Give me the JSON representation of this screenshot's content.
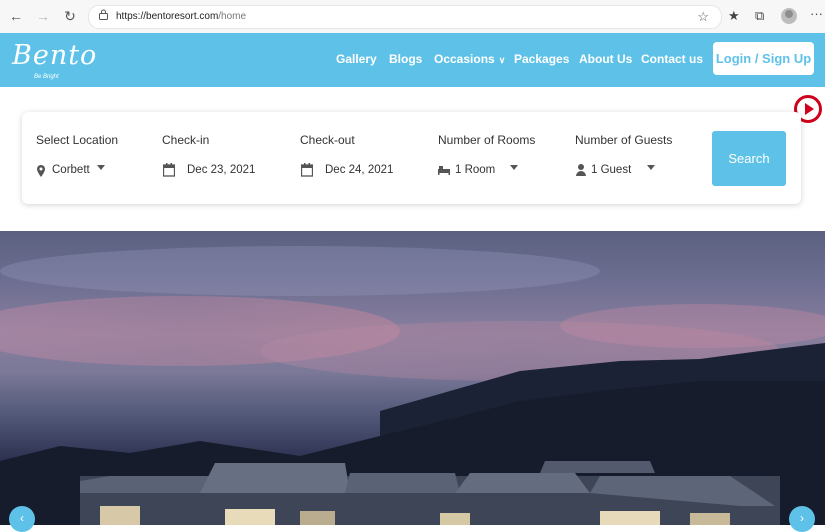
{
  "browser": {
    "url_host": "https://bentoresort.com",
    "url_path": "/home"
  },
  "header": {
    "logo_text": "Bento",
    "logo_sub": "Be Bright",
    "nav": [
      {
        "label": "Gallery"
      },
      {
        "label": "Blogs"
      },
      {
        "label": "Occasions"
      },
      {
        "label": "Packages"
      },
      {
        "label": "About Us"
      },
      {
        "label": "Contact us"
      }
    ],
    "login_label": "Login / Sign Up"
  },
  "booking": {
    "location": {
      "label": "Select Location",
      "value": "Corbett"
    },
    "checkin": {
      "label": "Check-in",
      "value": "Dec 23, 2021"
    },
    "checkout": {
      "label": "Check-out",
      "value": "Dec 24, 2021"
    },
    "rooms": {
      "label": "Number of Rooms",
      "value": "1 Room"
    },
    "guests": {
      "label": "Number of Guests",
      "value": "1 Guest"
    },
    "search_label": "Search"
  },
  "colors": {
    "brand": "#5ec2e8",
    "video_icon": "#d0021b"
  },
  "icons": [
    "back-icon",
    "forward-icon",
    "reload-icon",
    "lock-icon",
    "favorite-star-icon",
    "favorites-icon",
    "collections-icon",
    "more-icon",
    "location-pin-icon",
    "calendar-icon",
    "bed-icon",
    "person-icon",
    "video-play-icon",
    "chevron-left-icon",
    "chevron-right-icon"
  ]
}
